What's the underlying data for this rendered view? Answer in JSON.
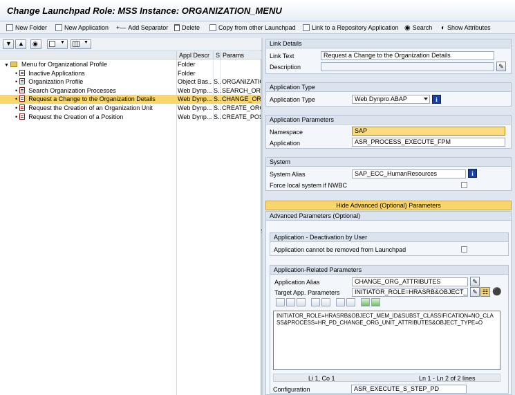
{
  "window": {
    "title": "Change Launchpad Role: MSS Instance: ORGANIZATION_MENU"
  },
  "toolbar": {
    "new_folder": "New Folder",
    "new_application": "New Application",
    "add_separator": "Add Separator",
    "delete": "Delete",
    "copy_from_other": "Copy from other Launchpad",
    "link_to_repository": "Link to a Repository Application",
    "search": "Search",
    "show_attributes": "Show Attributes"
  },
  "tree": {
    "columns": {
      "appl_descr": "Appl Descr",
      "s": "S",
      "params": "Params"
    },
    "rows": [
      {
        "label": "Menu for Organizational Profile",
        "descr": "Folder",
        "s": "",
        "params": ""
      },
      {
        "label": "Inactive Applications",
        "descr": "Folder",
        "s": "",
        "params": ""
      },
      {
        "label": "Organization Profile",
        "descr": "Object Bas...",
        "s": "S...",
        "params": "ORGANIZATIO"
      },
      {
        "label": "Search Organization Processes",
        "descr": "Web Dynp...",
        "s": "S...",
        "params": "SEARCH_ORG"
      },
      {
        "label": "Request a Change to the Organization Details",
        "descr": "Web Dynp...",
        "s": "S...",
        "params": "CHANGE_ORG"
      },
      {
        "label": "Request the Creation of an Organization Unit",
        "descr": "Web Dynp...",
        "s": "S...",
        "params": "CREATE_ORG"
      },
      {
        "label": "Request the Creation of a Position",
        "descr": "Web Dynp...",
        "s": "S...",
        "params": "CREATE_POS"
      }
    ]
  },
  "link_details": {
    "header": "Link Details",
    "link_text_label": "Link Text",
    "link_text_value": "Request a Change to the Organization Details",
    "description_label": "Description",
    "description_value": ""
  },
  "application_type": {
    "header": "Application Type",
    "label": "Application Type",
    "value": "Web Dynpro ABAP"
  },
  "application_parameters": {
    "header": "Application Parameters",
    "namespace_label": "Namespace",
    "namespace_value": "SAP",
    "application_label": "Application",
    "application_value": "ASR_PROCESS_EXECUTE_FPM"
  },
  "system": {
    "header": "System",
    "alias_label": "System Alias",
    "alias_value": "SAP_ECC_HumanResources",
    "force_local_label": "Force local system if NWBC"
  },
  "hide_advanced_button": "Hide Advanced (Optional) Parameters",
  "advanced": {
    "header": "Advanced Parameters (Optional)",
    "deactivation_header": "Application - Deactivation by User",
    "cannot_remove_label": "Application cannot be removed from Launchpad",
    "related_header": "Application-Related Parameters",
    "alias_label": "Application Alias",
    "alias_value": "CHANGE_ORG_ATTRIBUTES",
    "target_label": "Target App. Parameters",
    "target_value": "INITIATOR_ROLE=HRASRB&OBJECT_ME...",
    "editor_text": "INITIATOR_ROLE=HRASRB&OBJECT_MEM_ID&SUBST_CLASSIFICATION=NO_CLASS&PROCESS=HR_PD_CHANGE_ORG_UNIT_ATTRIBUTES&OBJECT_TYPE=O",
    "cursor_pos": "Li 1, Co 1",
    "line_range": "Ln 1 - Ln 2 of 2 lines",
    "configuration_label": "Configuration",
    "configuration_value": "ASR_EXECUTE_S_STEP_PD"
  },
  "colors": {
    "selection": "#f8d66b",
    "info_button": "#1d3f9c",
    "panel_bg": "#dfe6ef"
  }
}
